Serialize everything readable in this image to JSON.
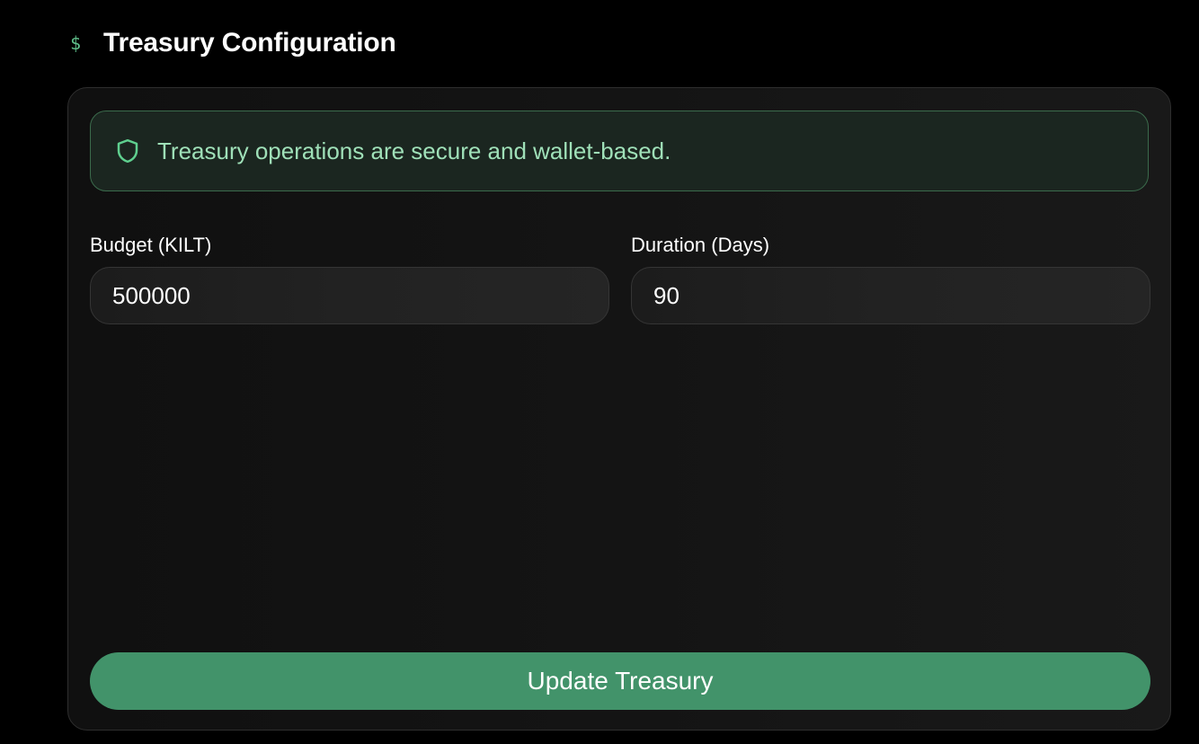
{
  "header": {
    "icon": "dollar-icon",
    "title": "Treasury Configuration"
  },
  "notice": {
    "icon": "shield-icon",
    "text": "Treasury operations are secure and wallet-based."
  },
  "form": {
    "budget": {
      "label": "Budget (KILT)",
      "value": "500000"
    },
    "duration": {
      "label": "Duration (Days)",
      "value": "90"
    }
  },
  "actions": {
    "submit_label": "Update Treasury"
  },
  "colors": {
    "accent": "#42936a",
    "accent_text": "#9fe0b8",
    "background": "#000000"
  }
}
